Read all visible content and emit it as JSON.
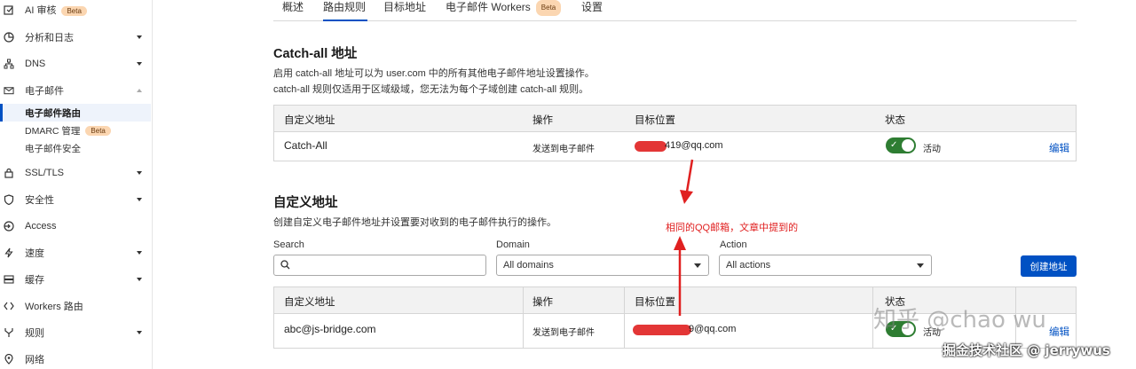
{
  "sidebar": {
    "items": [
      {
        "label": "AI 审核",
        "beta": "Beta"
      },
      {
        "label": "分析和日志"
      },
      {
        "label": "DNS"
      },
      {
        "label": "电子邮件"
      },
      {
        "label": "SSL/TLS"
      },
      {
        "label": "安全性"
      },
      {
        "label": "Access"
      },
      {
        "label": "速度"
      },
      {
        "label": "缓存"
      },
      {
        "label": "Workers 路由"
      },
      {
        "label": "规则"
      },
      {
        "label": "网络"
      }
    ],
    "email_sub": [
      {
        "label": "电子邮件路由"
      },
      {
        "label": "DMARC 管理",
        "beta": "Beta"
      },
      {
        "label": "电子邮件安全"
      }
    ]
  },
  "tabs": [
    {
      "label": "概述"
    },
    {
      "label": "路由规则"
    },
    {
      "label": "目标地址"
    },
    {
      "label": "电子邮件 Workers",
      "beta": "Beta"
    },
    {
      "label": "设置"
    }
  ],
  "catchall": {
    "title": "Catch-all 地址",
    "desc1": "启用 catch-all 地址可以为 user.com 中的所有其他电子邮件地址设置操作。",
    "desc2": "catch-all 规则仅适用于区域级域，您无法为每个子域创建 catch-all 规则。",
    "headers": [
      "自定义地址",
      "操作",
      "目标位置",
      "状态"
    ],
    "row": {
      "address": "Catch-All",
      "action": "发送到电子邮件",
      "dest": "419@qq.com",
      "status": "活动",
      "edit": "编辑"
    }
  },
  "custom": {
    "title": "自定义地址",
    "desc": "创建自定义电子邮件地址并设置要对收到的电子邮件执行的操作。",
    "search_label": "Search",
    "domain_label": "Domain",
    "domain_value": "All domains",
    "action_label": "Action",
    "action_value": "All actions",
    "create_button": "创建地址",
    "headers": [
      "自定义地址",
      "操作",
      "目标位置",
      "状态"
    ],
    "row": {
      "address": "abc@js-bridge.com",
      "action": "发送到电子邮件",
      "dest": "9@qq.com",
      "status": "活动",
      "edit": "编辑"
    }
  },
  "annotation": "相同的QQ邮箱，文章中提到的",
  "watermarks": {
    "zhihu": "知乎 @chao wu",
    "juejin": "掘金技术社区 @ jerrywus"
  },
  "colors": {
    "accent": "#0051c3",
    "toggle": "#2e7d32",
    "annotation": "#e02020",
    "beta": "#fbd6b1"
  }
}
